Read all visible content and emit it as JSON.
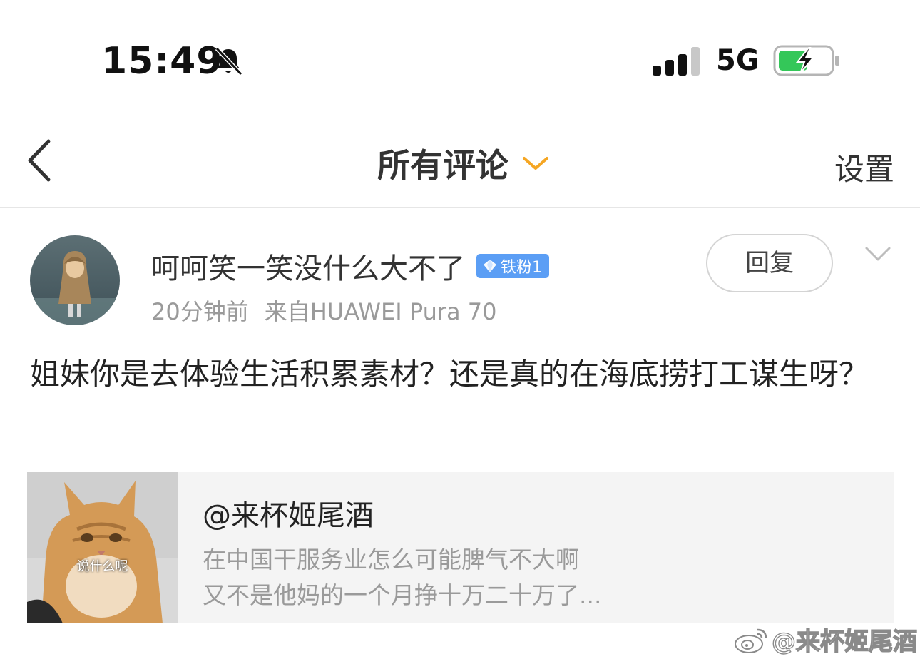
{
  "status_bar": {
    "time": "15:49",
    "network": "5G",
    "signal_bars_filled": 3,
    "signal_bars_total": 4,
    "battery_charging": true,
    "silent_mode": true
  },
  "nav": {
    "title": "所有评论",
    "settings_label": "设置",
    "accent_color": "#f5a623"
  },
  "comment": {
    "username": "呵呵笑一笑没什么大不了",
    "fan_badge": "铁粉1",
    "time_ago": "20分钟前",
    "source": "来自HUAWEI Pura 70",
    "reply_label": "回复",
    "text": "姐妹你是去体验生活积累素材？还是真的在海底捞打工谋生呀？"
  },
  "quote": {
    "author": "@来杯姬尾酒",
    "line1": "在中国干服务业怎么可能脾气不大啊",
    "line2": "又不是他妈的一个月挣十万二十万了...",
    "thumb_caption": "说什么呢"
  },
  "watermark": {
    "text": "@来杯姬尾酒"
  }
}
